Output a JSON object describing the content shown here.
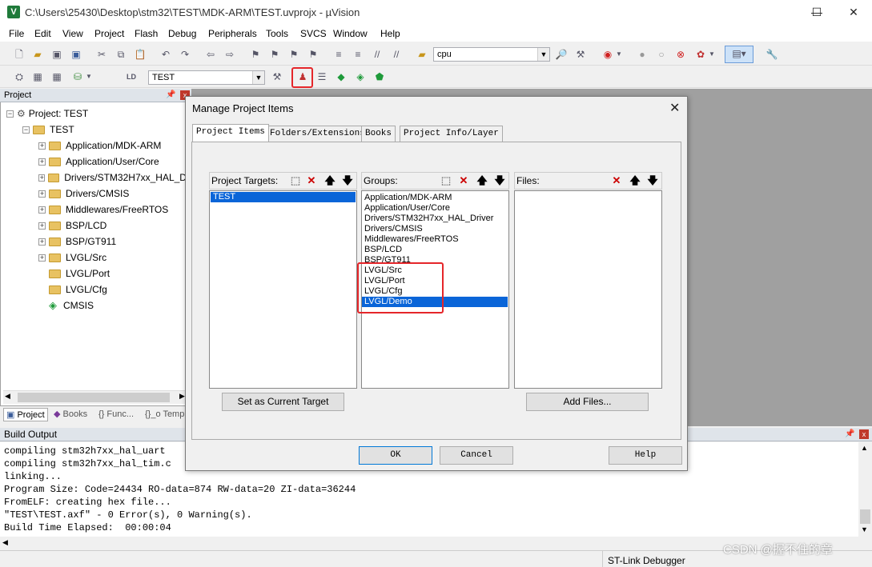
{
  "window": {
    "title": "C:\\Users\\25430\\Desktop\\stm32\\TEST\\MDK-ARM\\TEST.uvprojx - µVision",
    "minimize": "—",
    "maximize": "☐",
    "close": "✕"
  },
  "menu": [
    "File",
    "Edit",
    "View",
    "Project",
    "Flash",
    "Debug",
    "Peripherals",
    "Tools",
    "SVCS",
    "Window",
    "Help"
  ],
  "toolbar": {
    "device_combo": "cpu",
    "target_combo": "TEST"
  },
  "project_panel": {
    "title": "Project",
    "root": "Project: TEST",
    "target": "TEST",
    "groups": [
      "Application/MDK-ARM",
      "Application/User/Core",
      "Drivers/STM32H7xx_HAL_D",
      "Drivers/CMSIS",
      "Middlewares/FreeRTOS",
      "BSP/LCD",
      "BSP/GT911",
      "LVGL/Src",
      "LVGL/Port",
      "LVGL/Cfg",
      "CMSIS"
    ],
    "tabs": [
      "Project",
      "Books",
      "{} Func...",
      "{}_o Temp..."
    ]
  },
  "dialog": {
    "title": "Manage Project Items",
    "tabs": [
      "Project Items",
      "Folders/Extensions",
      "Books",
      "Project Info/Layer"
    ],
    "targets_label": "Project Targets:",
    "groups_label": "Groups:",
    "files_label": "Files:",
    "targets": [
      "TEST"
    ],
    "groups": [
      "Application/MDK-ARM",
      "Application/User/Core",
      "Drivers/STM32H7xx_HAL_Driver",
      "Drivers/CMSIS",
      "Middlewares/FreeRTOS",
      "BSP/LCD",
      "BSP/GT911",
      "LVGL/Src",
      "LVGL/Port",
      "LVGL/Cfg",
      "LVGL/Demo"
    ],
    "selected_group": "LVGL/Demo",
    "set_current": "Set as Current Target",
    "add_files": "Add Files...",
    "ok": "OK",
    "cancel": "Cancel",
    "help": "Help"
  },
  "build_output": {
    "title": "Build Output",
    "lines": [
      "compiling stm32h7xx_hal_uart",
      "compiling stm32h7xx_hal_tim.c",
      "linking...",
      "Program Size: Code=24434 RO-data=874 RW-data=20 ZI-data=36244",
      "FromELF: creating hex file...",
      "\"TEST\\TEST.axf\" - 0 Error(s), 0 Warning(s).",
      "Build Time Elapsed:  00:00:04"
    ]
  },
  "status": {
    "debugger": "ST-Link Debugger"
  },
  "watermark": "CSDN @握不住的章",
  "colors": {
    "selection": "#0a65d8",
    "highlight_box": "#e5262a"
  }
}
